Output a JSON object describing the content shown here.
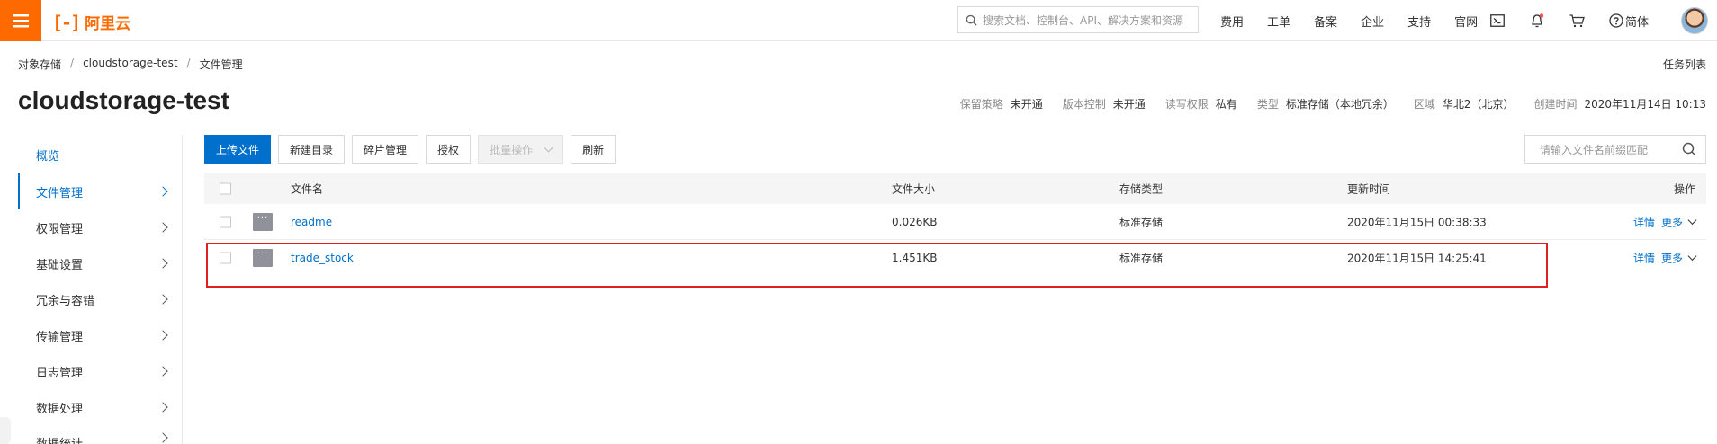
{
  "topbar": {
    "logo_mark": "[-]",
    "logo_text": "阿里云",
    "search_placeholder": "搜索文档、控制台、API、解决方案和资源",
    "nav": [
      "费用",
      "工单",
      "备案",
      "企业",
      "支持",
      "官网"
    ],
    "language": "简体",
    "icons": [
      "terminal-icon",
      "bell-icon",
      "cart-icon",
      "help-icon"
    ],
    "accent_color": "#ff6a00"
  },
  "breadcrumb": [
    "对象存储",
    "cloudstorage-test",
    "文件管理"
  ],
  "task_list": "任务列表",
  "bucket": {
    "title": "cloudstorage-test",
    "meta": [
      {
        "k": "保留策略",
        "v": "未开通"
      },
      {
        "k": "版本控制",
        "v": "未开通"
      },
      {
        "k": "读写权限",
        "v": "私有"
      },
      {
        "k": "类型",
        "v": "标准存储（本地冗余）"
      },
      {
        "k": "区域",
        "v": "华北2（北京）"
      },
      {
        "k": "创建时间",
        "v": "2020年11月14日 10:13"
      }
    ]
  },
  "sidebar": {
    "items": [
      {
        "label": "概览"
      },
      {
        "label": "文件管理"
      },
      {
        "label": "权限管理"
      },
      {
        "label": "基础设置"
      },
      {
        "label": "冗余与容错"
      },
      {
        "label": "传输管理"
      },
      {
        "label": "日志管理"
      },
      {
        "label": "数据处理"
      },
      {
        "label": "数据统计"
      }
    ]
  },
  "toolbar": {
    "upload": "上传文件",
    "new_dir": "新建目录",
    "fragments": "碎片管理",
    "authorize": "授权",
    "batch": "批量操作",
    "refresh": "刷新",
    "search_placeholder": "请输入文件名前缀匹配"
  },
  "table": {
    "headers": {
      "name": "文件名",
      "size": "文件大小",
      "type": "存储类型",
      "time": "更新时间",
      "ops": "操作"
    },
    "rows": [
      {
        "name": "readme",
        "size": "0.026KB",
        "type": "标准存储",
        "time": "2020年11月15日 00:38:33",
        "detail": "详情",
        "more": "更多"
      },
      {
        "name": "trade_stock",
        "size": "1.451KB",
        "type": "标准存储",
        "time": "2020年11月15日 14:25:41",
        "detail": "详情",
        "more": "更多"
      }
    ]
  },
  "colors": {
    "primary": "#0070cc",
    "highlight": "#e02020"
  }
}
